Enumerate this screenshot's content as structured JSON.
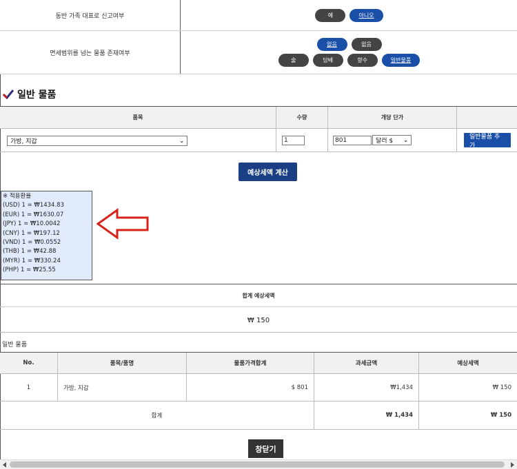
{
  "options": [
    {
      "label": "동반 가족 대표로 신고여부",
      "choices": [
        {
          "text": "예",
          "selected": false
        },
        {
          "text": "아니오",
          "selected": true
        }
      ]
    },
    {
      "label": "면세범위를 넘는 물품 존재여부",
      "choices_line1": [
        {
          "text": "없음",
          "selected": true
        },
        {
          "text": "없음",
          "selected": false
        }
      ],
      "choices_line2": [
        {
          "text": "술",
          "selected": false
        },
        {
          "text": "담배",
          "selected": false
        },
        {
          "text": "향수",
          "selected": false
        },
        {
          "text": "일반물품",
          "selected": true
        }
      ]
    }
  ],
  "section": {
    "title": "일반 물품",
    "icon": "checkmark-icon"
  },
  "items_table": {
    "headers": {
      "item": "품목",
      "qty": "수량",
      "unit_price": "개당 단가"
    },
    "row": {
      "item_select": "가방, 지갑",
      "qty": "1",
      "price": "801",
      "currency": "달러 $",
      "add_button": "일반물품 추가"
    }
  },
  "calc_button": "예상세액 계산",
  "rates": {
    "title": "※ 적용환율",
    "lines": [
      "(USD) 1 = ₩1434.83",
      "(EUR) 1 = ₩1630.07",
      "(JPY) 1 = ₩10.0042",
      "(CNY) 1 = ₩197.12",
      "(VND) 1 = ₩0.0552",
      "(THB) 1 = ₩42.88",
      "(MYR) 1 = ₩330.24",
      "(PHP) 1 = ₩25.55"
    ]
  },
  "total": {
    "label": "합계 예상세액",
    "value": "₩ 150"
  },
  "detail_caption": "일반 물품",
  "detail_table": {
    "headers": [
      "No.",
      "품목/품명",
      "물품가격합계",
      "과세금액",
      "예상세액"
    ],
    "rows": [
      {
        "no": "1",
        "name": "가방, 지갑",
        "price": "$ 801",
        "taxable": "₩1,434",
        "tax": "₩ 150"
      }
    ],
    "sum": {
      "label": "합계",
      "taxable": "₩ 1,434",
      "tax": "₩ 150"
    }
  },
  "close_button": "창닫기",
  "colors": {
    "accent_blue": "#1a4fa8",
    "dark_pill": "#444444",
    "rates_bg": "#e1ebfb",
    "arrow_red": "#d9211b",
    "check_mark": "#2b2f7a"
  }
}
